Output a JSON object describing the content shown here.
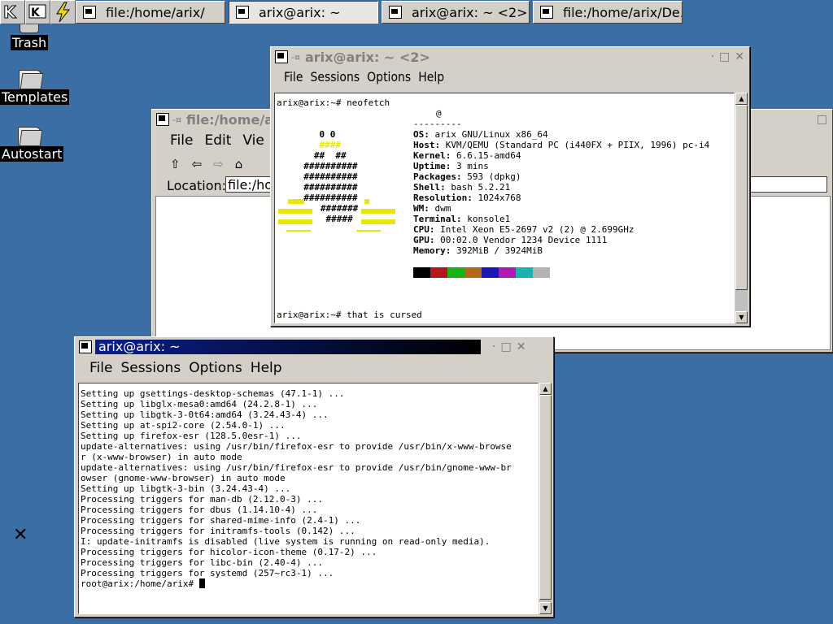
{
  "taskbar": {
    "tasks": [
      {
        "label": "file:/home/arix/",
        "active": false
      },
      {
        "label": "arix@arix: ~",
        "active": true
      },
      {
        "label": "arix@arix: ~ <2>",
        "active": false
      },
      {
        "label": "file:/home/arix/De...",
        "active": false
      }
    ]
  },
  "desktop": {
    "icons": [
      {
        "label": "Trash"
      },
      {
        "label": "Templates"
      },
      {
        "label": "Autostart"
      }
    ]
  },
  "filemanager": {
    "title": "file:/home/ar",
    "menus": [
      "File",
      "Edit",
      "Vie"
    ],
    "location_label": "Location:",
    "location_value": "file:/hom"
  },
  "term2": {
    "title": "arix@arix: ~ <2>",
    "menus": [
      "File",
      "Sessions",
      "Options",
      "Help"
    ],
    "prompt_line": "arix@arix:~# neofetch",
    "logo": {
      "line1": "    0 0",
      "line2": "    ####",
      "line3": "   ##  ##",
      "line4": "  ##########",
      "line5": "  ##########",
      "line6": "  ##########",
      "line7": "  ##########",
      "line8": "   #######",
      "line9": "    #####",
      "line10": " "
    },
    "header_user": "@",
    "header_sep": "---------",
    "info": [
      {
        "k": "OS:",
        "v": " arix GNU/Linux x86_64"
      },
      {
        "k": "Host:",
        "v": " KVM/QEMU (Standard PC (i440FX + PIIX, 1996) pc-i4"
      },
      {
        "k": "Kernel:",
        "v": " 6.6.15-amd64"
      },
      {
        "k": "Uptime:",
        "v": " 3 mins"
      },
      {
        "k": "Packages:",
        "v": " 593 (dpkg)"
      },
      {
        "k": "Shell:",
        "v": " bash 5.2.21"
      },
      {
        "k": "Resolution:",
        "v": " 1024x768"
      },
      {
        "k": "WM:",
        "v": " dwm"
      },
      {
        "k": "Terminal:",
        "v": " konsole1"
      },
      {
        "k": "CPU:",
        "v": " Intel Xeon E5-2697 v2 (2) @ 2.699GHz"
      },
      {
        "k": "GPU:",
        "v": " 00:02.0 Vendor 1234 Device 1111"
      },
      {
        "k": "Memory:",
        "v": " 392MiB / 3924MiB"
      }
    ],
    "palette": [
      "#000000",
      "#b21818",
      "#18b218",
      "#b26818",
      "#1818b2",
      "#b218b2",
      "#18b2b2",
      "#b2b2b2"
    ],
    "last_line": "arix@arix:~# that is cursed"
  },
  "term1": {
    "title": "arix@arix: ~",
    "menus": [
      "File",
      "Sessions",
      "Options",
      "Help"
    ],
    "lines": [
      "Setting up gsettings-desktop-schemas (47.1-1) ...",
      "Setting up libglx-mesa0:amd64 (24.2.8-1) ...",
      "Setting up libgtk-3-0t64:amd64 (3.24.43-4) ...",
      "Setting up at-spi2-core (2.54.0-1) ...",
      "Setting up firefox-esr (128.5.0esr-1) ...",
      "update-alternatives: using /usr/bin/firefox-esr to provide /usr/bin/x-www-browse",
      "r (x-www-browser) in auto mode",
      "update-alternatives: using /usr/bin/firefox-esr to provide /usr/bin/gnome-www-br",
      "owser (gnome-www-browser) in auto mode",
      "Setting up libgtk-3-bin (3.24.43-4) ...",
      "Processing triggers for man-db (2.12.0-3) ...",
      "Processing triggers for dbus (1.14.10-4) ...",
      "Processing triggers for shared-mime-info (2.4-1) ...",
      "Processing triggers for initramfs-tools (0.142) ...",
      "I: update-initramfs is disabled (live system is running on read-only media).",
      "Processing triggers for hicolor-icon-theme (0.17-2) ...",
      "Processing triggers for libc-bin (2.40-4) ...",
      "Processing triggers for systemd (257~rc3-1) ..."
    ],
    "prompt": "root@arix:/home/arix# "
  }
}
